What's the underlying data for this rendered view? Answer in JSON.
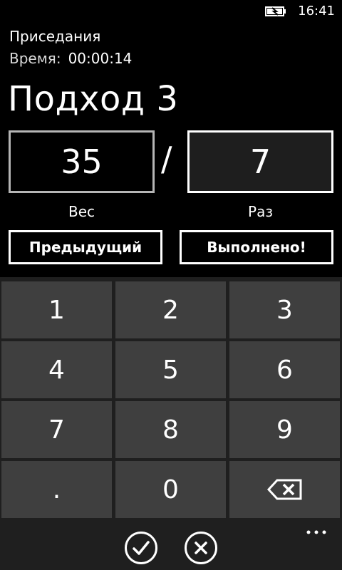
{
  "status_bar": {
    "battery_icon": "battery-charging-icon",
    "time": "16:41"
  },
  "header": {
    "exercise": "Приседания",
    "time_label": "Время:",
    "time_value": "00:00:14",
    "set_title": "Подход 3"
  },
  "inputs": {
    "weight_value": "35",
    "separator": "/",
    "reps_value": "7",
    "weight_label": "Вес",
    "reps_label": "Раз"
  },
  "actions": {
    "previous_label": "Предыдущий",
    "done_label": "Выполнено!"
  },
  "keypad": {
    "keys": [
      "1",
      "2",
      "3",
      "4",
      "5",
      "6",
      "7",
      "8",
      "9",
      ".",
      "0"
    ],
    "backspace_icon": "backspace-icon"
  },
  "app_bar": {
    "confirm_icon": "check-circle-icon",
    "cancel_icon": "close-circle-icon",
    "more_icon": "ellipsis-icon"
  },
  "colors": {
    "background": "#000000",
    "keypad_background": "#1f1f1f",
    "key_background": "#3f3f3f",
    "foreground": "#ffffff"
  }
}
